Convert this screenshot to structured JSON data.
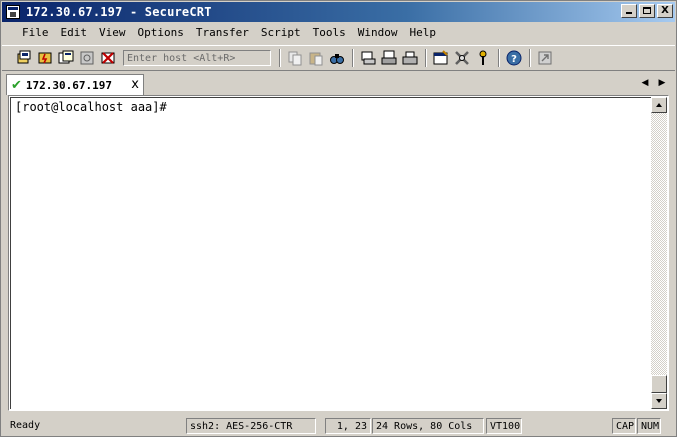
{
  "window": {
    "title": "172.30.67.197 - SecureCRT",
    "buttons": {
      "minimize": "_",
      "maximize": "□",
      "close": "X"
    }
  },
  "menu": [
    "File",
    "Edit",
    "View",
    "Options",
    "Transfer",
    "Script",
    "Tools",
    "Window",
    "Help"
  ],
  "toolbar": {
    "host_placeholder": "Enter host <Alt+R>",
    "icons": [
      "connect-icon",
      "quick-connect-icon",
      "connect-in-tab-icon",
      "reconnect-icon",
      "disconnect-icon",
      "copy-icon",
      "paste-icon",
      "find-icon",
      "print-screen-icon",
      "print-selection-icon",
      "print-icon",
      "session-options-icon",
      "global-options-icon",
      "keymap-icon",
      "help-icon",
      "sftp-icon"
    ]
  },
  "tab": {
    "label": "172.30.67.197",
    "close": "x",
    "status_color": "#2aa02a"
  },
  "terminal": {
    "lines": [
      "[root@localhost aaa]#"
    ]
  },
  "statusbar": {
    "ready": "Ready",
    "cipher": "ssh2: AES-256-CTR",
    "position": "1,  23",
    "size": "24 Rows, 80 Cols",
    "emulation": "VT100",
    "caps": "CAP",
    "num": "NUM"
  },
  "colors": {
    "title_gradient_start": "#0a246a",
    "title_gradient_end": "#a6caf0",
    "chrome": "#d4d0c8"
  }
}
